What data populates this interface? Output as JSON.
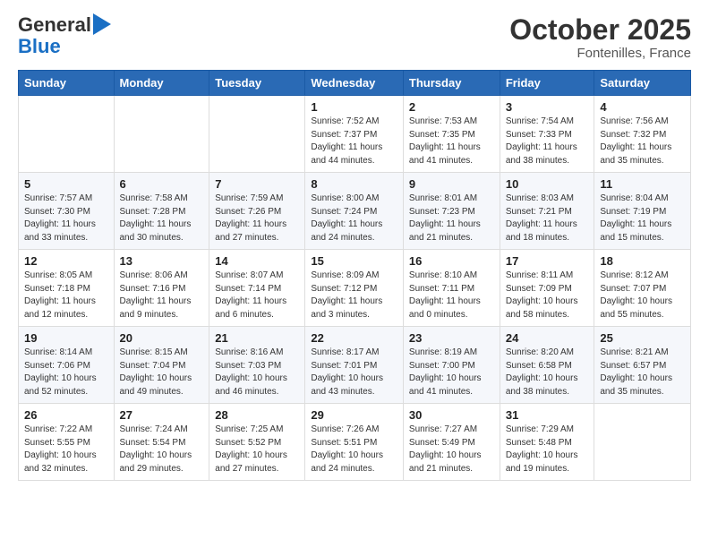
{
  "header": {
    "logo_general": "General",
    "logo_blue": "Blue",
    "month": "October 2025",
    "location": "Fontenilles, France"
  },
  "weekdays": [
    "Sunday",
    "Monday",
    "Tuesday",
    "Wednesday",
    "Thursday",
    "Friday",
    "Saturday"
  ],
  "weeks": [
    [
      {
        "day": "",
        "info": ""
      },
      {
        "day": "",
        "info": ""
      },
      {
        "day": "",
        "info": ""
      },
      {
        "day": "1",
        "info": "Sunrise: 7:52 AM\nSunset: 7:37 PM\nDaylight: 11 hours\nand 44 minutes."
      },
      {
        "day": "2",
        "info": "Sunrise: 7:53 AM\nSunset: 7:35 PM\nDaylight: 11 hours\nand 41 minutes."
      },
      {
        "day": "3",
        "info": "Sunrise: 7:54 AM\nSunset: 7:33 PM\nDaylight: 11 hours\nand 38 minutes."
      },
      {
        "day": "4",
        "info": "Sunrise: 7:56 AM\nSunset: 7:32 PM\nDaylight: 11 hours\nand 35 minutes."
      }
    ],
    [
      {
        "day": "5",
        "info": "Sunrise: 7:57 AM\nSunset: 7:30 PM\nDaylight: 11 hours\nand 33 minutes."
      },
      {
        "day": "6",
        "info": "Sunrise: 7:58 AM\nSunset: 7:28 PM\nDaylight: 11 hours\nand 30 minutes."
      },
      {
        "day": "7",
        "info": "Sunrise: 7:59 AM\nSunset: 7:26 PM\nDaylight: 11 hours\nand 27 minutes."
      },
      {
        "day": "8",
        "info": "Sunrise: 8:00 AM\nSunset: 7:24 PM\nDaylight: 11 hours\nand 24 minutes."
      },
      {
        "day": "9",
        "info": "Sunrise: 8:01 AM\nSunset: 7:23 PM\nDaylight: 11 hours\nand 21 minutes."
      },
      {
        "day": "10",
        "info": "Sunrise: 8:03 AM\nSunset: 7:21 PM\nDaylight: 11 hours\nand 18 minutes."
      },
      {
        "day": "11",
        "info": "Sunrise: 8:04 AM\nSunset: 7:19 PM\nDaylight: 11 hours\nand 15 minutes."
      }
    ],
    [
      {
        "day": "12",
        "info": "Sunrise: 8:05 AM\nSunset: 7:18 PM\nDaylight: 11 hours\nand 12 minutes."
      },
      {
        "day": "13",
        "info": "Sunrise: 8:06 AM\nSunset: 7:16 PM\nDaylight: 11 hours\nand 9 minutes."
      },
      {
        "day": "14",
        "info": "Sunrise: 8:07 AM\nSunset: 7:14 PM\nDaylight: 11 hours\nand 6 minutes."
      },
      {
        "day": "15",
        "info": "Sunrise: 8:09 AM\nSunset: 7:12 PM\nDaylight: 11 hours\nand 3 minutes."
      },
      {
        "day": "16",
        "info": "Sunrise: 8:10 AM\nSunset: 7:11 PM\nDaylight: 11 hours\nand 0 minutes."
      },
      {
        "day": "17",
        "info": "Sunrise: 8:11 AM\nSunset: 7:09 PM\nDaylight: 10 hours\nand 58 minutes."
      },
      {
        "day": "18",
        "info": "Sunrise: 8:12 AM\nSunset: 7:07 PM\nDaylight: 10 hours\nand 55 minutes."
      }
    ],
    [
      {
        "day": "19",
        "info": "Sunrise: 8:14 AM\nSunset: 7:06 PM\nDaylight: 10 hours\nand 52 minutes."
      },
      {
        "day": "20",
        "info": "Sunrise: 8:15 AM\nSunset: 7:04 PM\nDaylight: 10 hours\nand 49 minutes."
      },
      {
        "day": "21",
        "info": "Sunrise: 8:16 AM\nSunset: 7:03 PM\nDaylight: 10 hours\nand 46 minutes."
      },
      {
        "day": "22",
        "info": "Sunrise: 8:17 AM\nSunset: 7:01 PM\nDaylight: 10 hours\nand 43 minutes."
      },
      {
        "day": "23",
        "info": "Sunrise: 8:19 AM\nSunset: 7:00 PM\nDaylight: 10 hours\nand 41 minutes."
      },
      {
        "day": "24",
        "info": "Sunrise: 8:20 AM\nSunset: 6:58 PM\nDaylight: 10 hours\nand 38 minutes."
      },
      {
        "day": "25",
        "info": "Sunrise: 8:21 AM\nSunset: 6:57 PM\nDaylight: 10 hours\nand 35 minutes."
      }
    ],
    [
      {
        "day": "26",
        "info": "Sunrise: 7:22 AM\nSunset: 5:55 PM\nDaylight: 10 hours\nand 32 minutes."
      },
      {
        "day": "27",
        "info": "Sunrise: 7:24 AM\nSunset: 5:54 PM\nDaylight: 10 hours\nand 29 minutes."
      },
      {
        "day": "28",
        "info": "Sunrise: 7:25 AM\nSunset: 5:52 PM\nDaylight: 10 hours\nand 27 minutes."
      },
      {
        "day": "29",
        "info": "Sunrise: 7:26 AM\nSunset: 5:51 PM\nDaylight: 10 hours\nand 24 minutes."
      },
      {
        "day": "30",
        "info": "Sunrise: 7:27 AM\nSunset: 5:49 PM\nDaylight: 10 hours\nand 21 minutes."
      },
      {
        "day": "31",
        "info": "Sunrise: 7:29 AM\nSunset: 5:48 PM\nDaylight: 10 hours\nand 19 minutes."
      },
      {
        "day": "",
        "info": ""
      }
    ]
  ]
}
